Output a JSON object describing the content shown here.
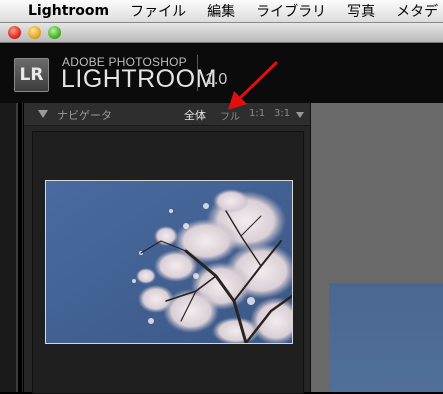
{
  "menubar": {
    "app_name": "Lightroom",
    "items": [
      "ファイル",
      "編集",
      "ライブラリ",
      "写真",
      "メタデ"
    ]
  },
  "identity_plate": {
    "badge": "LR",
    "line1": "ADOBE PHOTOSHOP",
    "line2": "LIGHTROOM",
    "version": "1.0"
  },
  "navigator": {
    "title": "ナビゲータ",
    "options": {
      "full": "全体",
      "fill": "フル",
      "one_to_one": "1:1",
      "three_to_one": "3:1"
    },
    "selected_option": "全体"
  },
  "icons": {
    "apple": "apple-icon",
    "collapse": "triangle-down-icon",
    "zoom_menu": "chevron-down-icon",
    "annotation": "red-arrow-icon"
  },
  "colors": {
    "arrow": "#e01010",
    "sky": "#3f5e8f",
    "panel": "#262626",
    "center": "#696969"
  }
}
